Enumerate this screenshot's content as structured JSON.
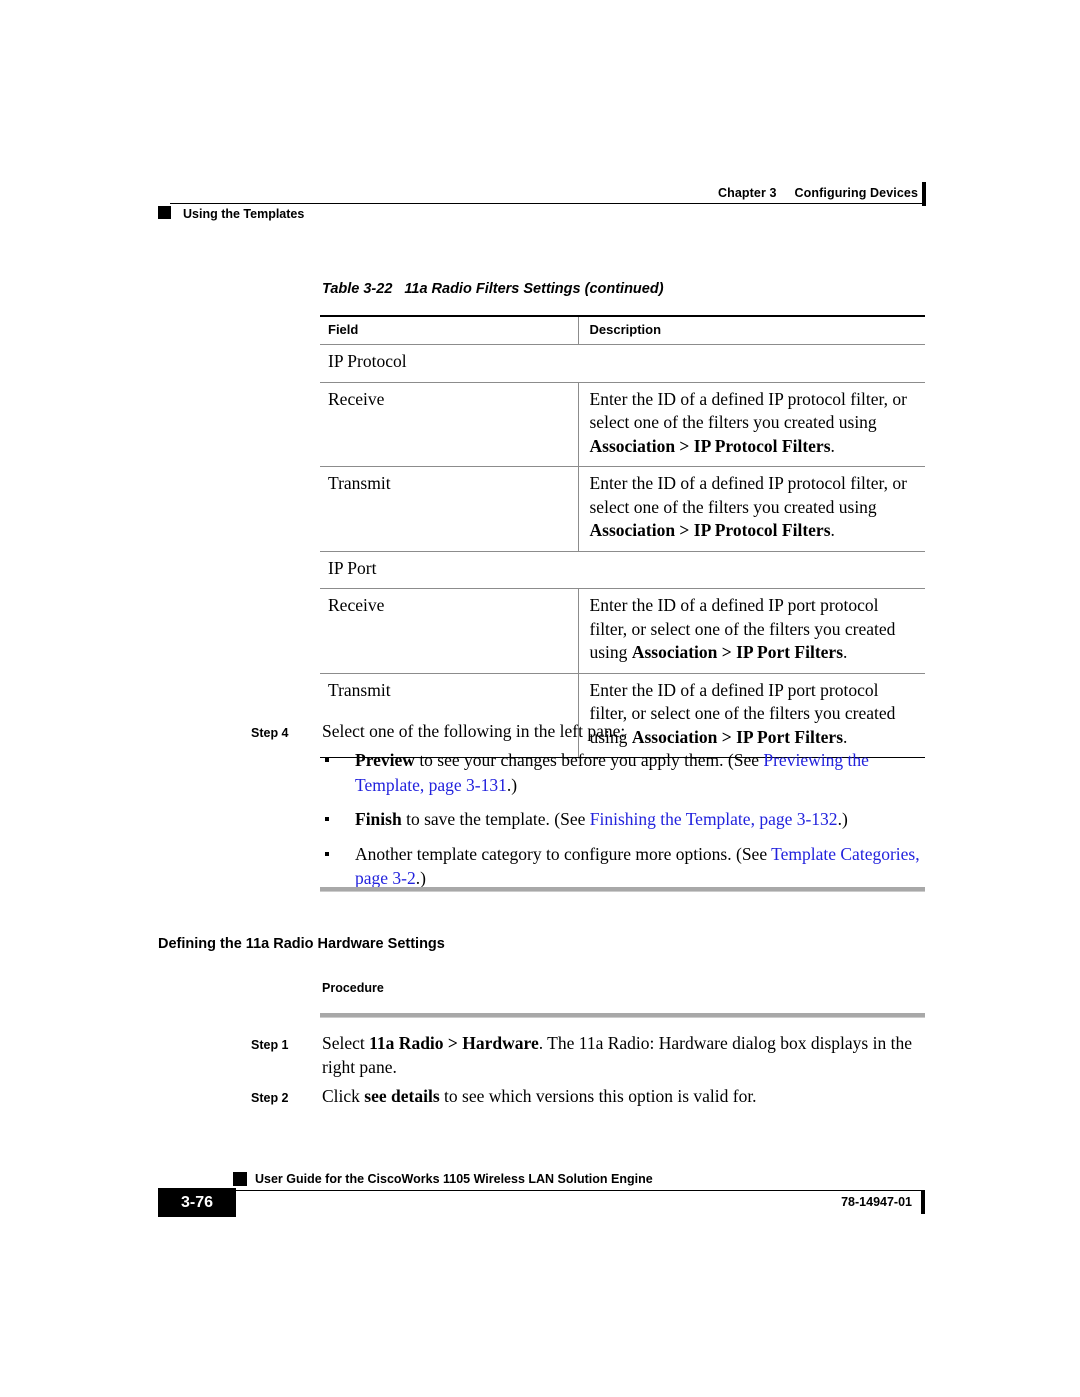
{
  "header": {
    "chapter": "Chapter 3",
    "chapter_title": "Configuring Devices",
    "section": "Using the Templates"
  },
  "table": {
    "caption_number": "Table 3-22",
    "caption_title": "11a Radio Filters Settings  (continued)",
    "columns": [
      "Field",
      "Description"
    ],
    "rows": [
      {
        "field": "IP Protocol",
        "description": "",
        "group": true
      },
      {
        "field": "Receive",
        "group": false,
        "desc_lines": [
          {
            "text": "Enter the ID of a defined IP protocol filter, or"
          },
          {
            "text": "select one of the filters you created using"
          },
          {
            "pre": "",
            "bold": "Association > IP Protocol Filters",
            "post": "."
          }
        ]
      },
      {
        "field": "Transmit",
        "group": false,
        "desc_lines": [
          {
            "text": "Enter the ID of a defined IP protocol filter, or"
          },
          {
            "text": "select one of the filters you created using"
          },
          {
            "pre": "",
            "bold": "Association > IP Protocol Filters",
            "post": "."
          }
        ]
      },
      {
        "field": "IP Port",
        "description": "",
        "group": true
      },
      {
        "field": "Receive",
        "group": false,
        "desc_lines": [
          {
            "text": "Enter the ID of a defined IP port protocol"
          },
          {
            "text": "filter, or select one of the filters you created"
          },
          {
            "pre": "using ",
            "bold": "Association > IP Port Filters",
            "post": "."
          }
        ]
      },
      {
        "field": "Transmit",
        "group": false,
        "desc_lines": [
          {
            "text": "Enter the ID of a defined IP port protocol"
          },
          {
            "text": "filter, or select one of the filters you created"
          },
          {
            "pre": "using ",
            "bold": "Association > IP Port Filters",
            "post": "."
          }
        ]
      }
    ]
  },
  "step4": {
    "label": "Step 4",
    "text": "Select one of the following in the left pane:",
    "bullets": [
      {
        "bold": "Preview",
        "text": " to see your changes before you apply them. (See ",
        "link": "Previewing the Template, page 3-131",
        "tail": ".)"
      },
      {
        "bold": "Finish",
        "text": " to save the template. (See ",
        "link": "Finishing the Template, page 3-132",
        "tail": ".)"
      },
      {
        "bold": "",
        "text": "Another template category to configure more options. (See ",
        "link": "Template Categories, page 3-2",
        "tail": ".)"
      }
    ]
  },
  "section_heading": "Defining the 11a Radio Hardware Settings",
  "procedure_label": "Procedure",
  "steps": [
    {
      "label": "Step 1",
      "pre": "Select ",
      "bold": "11a Radio > Hardware",
      "post": ". The 11a Radio: Hardware dialog box displays in the right pane."
    },
    {
      "label": "Step 2",
      "pre": "Click ",
      "bold": "see details",
      "post": " to see which versions this option is valid for."
    }
  ],
  "footer": {
    "title": "User Guide for the CiscoWorks 1105 Wireless LAN Solution Engine",
    "page_number": "3-76",
    "doc_number": "78-14947-01"
  },
  "colors": {
    "link": "#2222dd",
    "rule_gray": "#a8a8a8",
    "table_rule": "#8c8c8c"
  }
}
